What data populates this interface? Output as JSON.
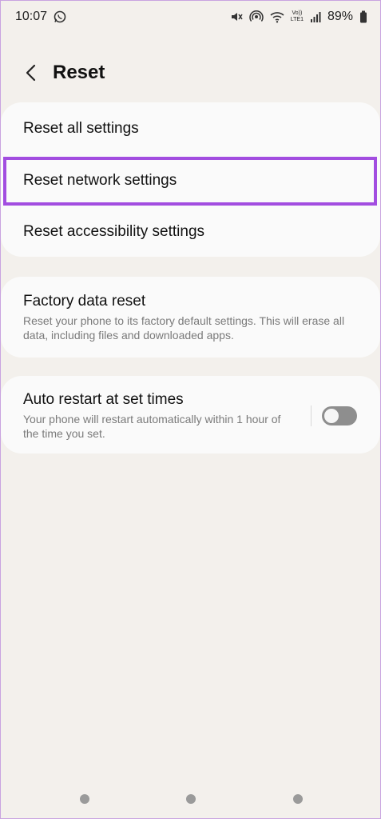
{
  "status_bar": {
    "time": "10:07",
    "battery": "89%",
    "network_label": "LTE1",
    "icons": [
      "whatsapp-icon",
      "mute-icon",
      "hotspot-icon",
      "wifi-icon",
      "volte-icon",
      "signal-icon",
      "battery-icon"
    ]
  },
  "header": {
    "title": "Reset"
  },
  "reset_group": {
    "items": [
      {
        "label": "Reset all settings"
      },
      {
        "label": "Reset network settings"
      },
      {
        "label": "Reset accessibility settings"
      }
    ],
    "highlight_color": "#a24de0"
  },
  "factory": {
    "title": "Factory data reset",
    "description": "Reset your phone to its factory default settings. This will erase all data, including files and downloaded apps."
  },
  "auto_restart": {
    "title": "Auto restart at set times",
    "description": "Your phone will restart automatically within 1 hour of the time you set.",
    "enabled": false
  },
  "nav_bar": {
    "buttons": [
      "recent-apps",
      "home",
      "back"
    ]
  }
}
